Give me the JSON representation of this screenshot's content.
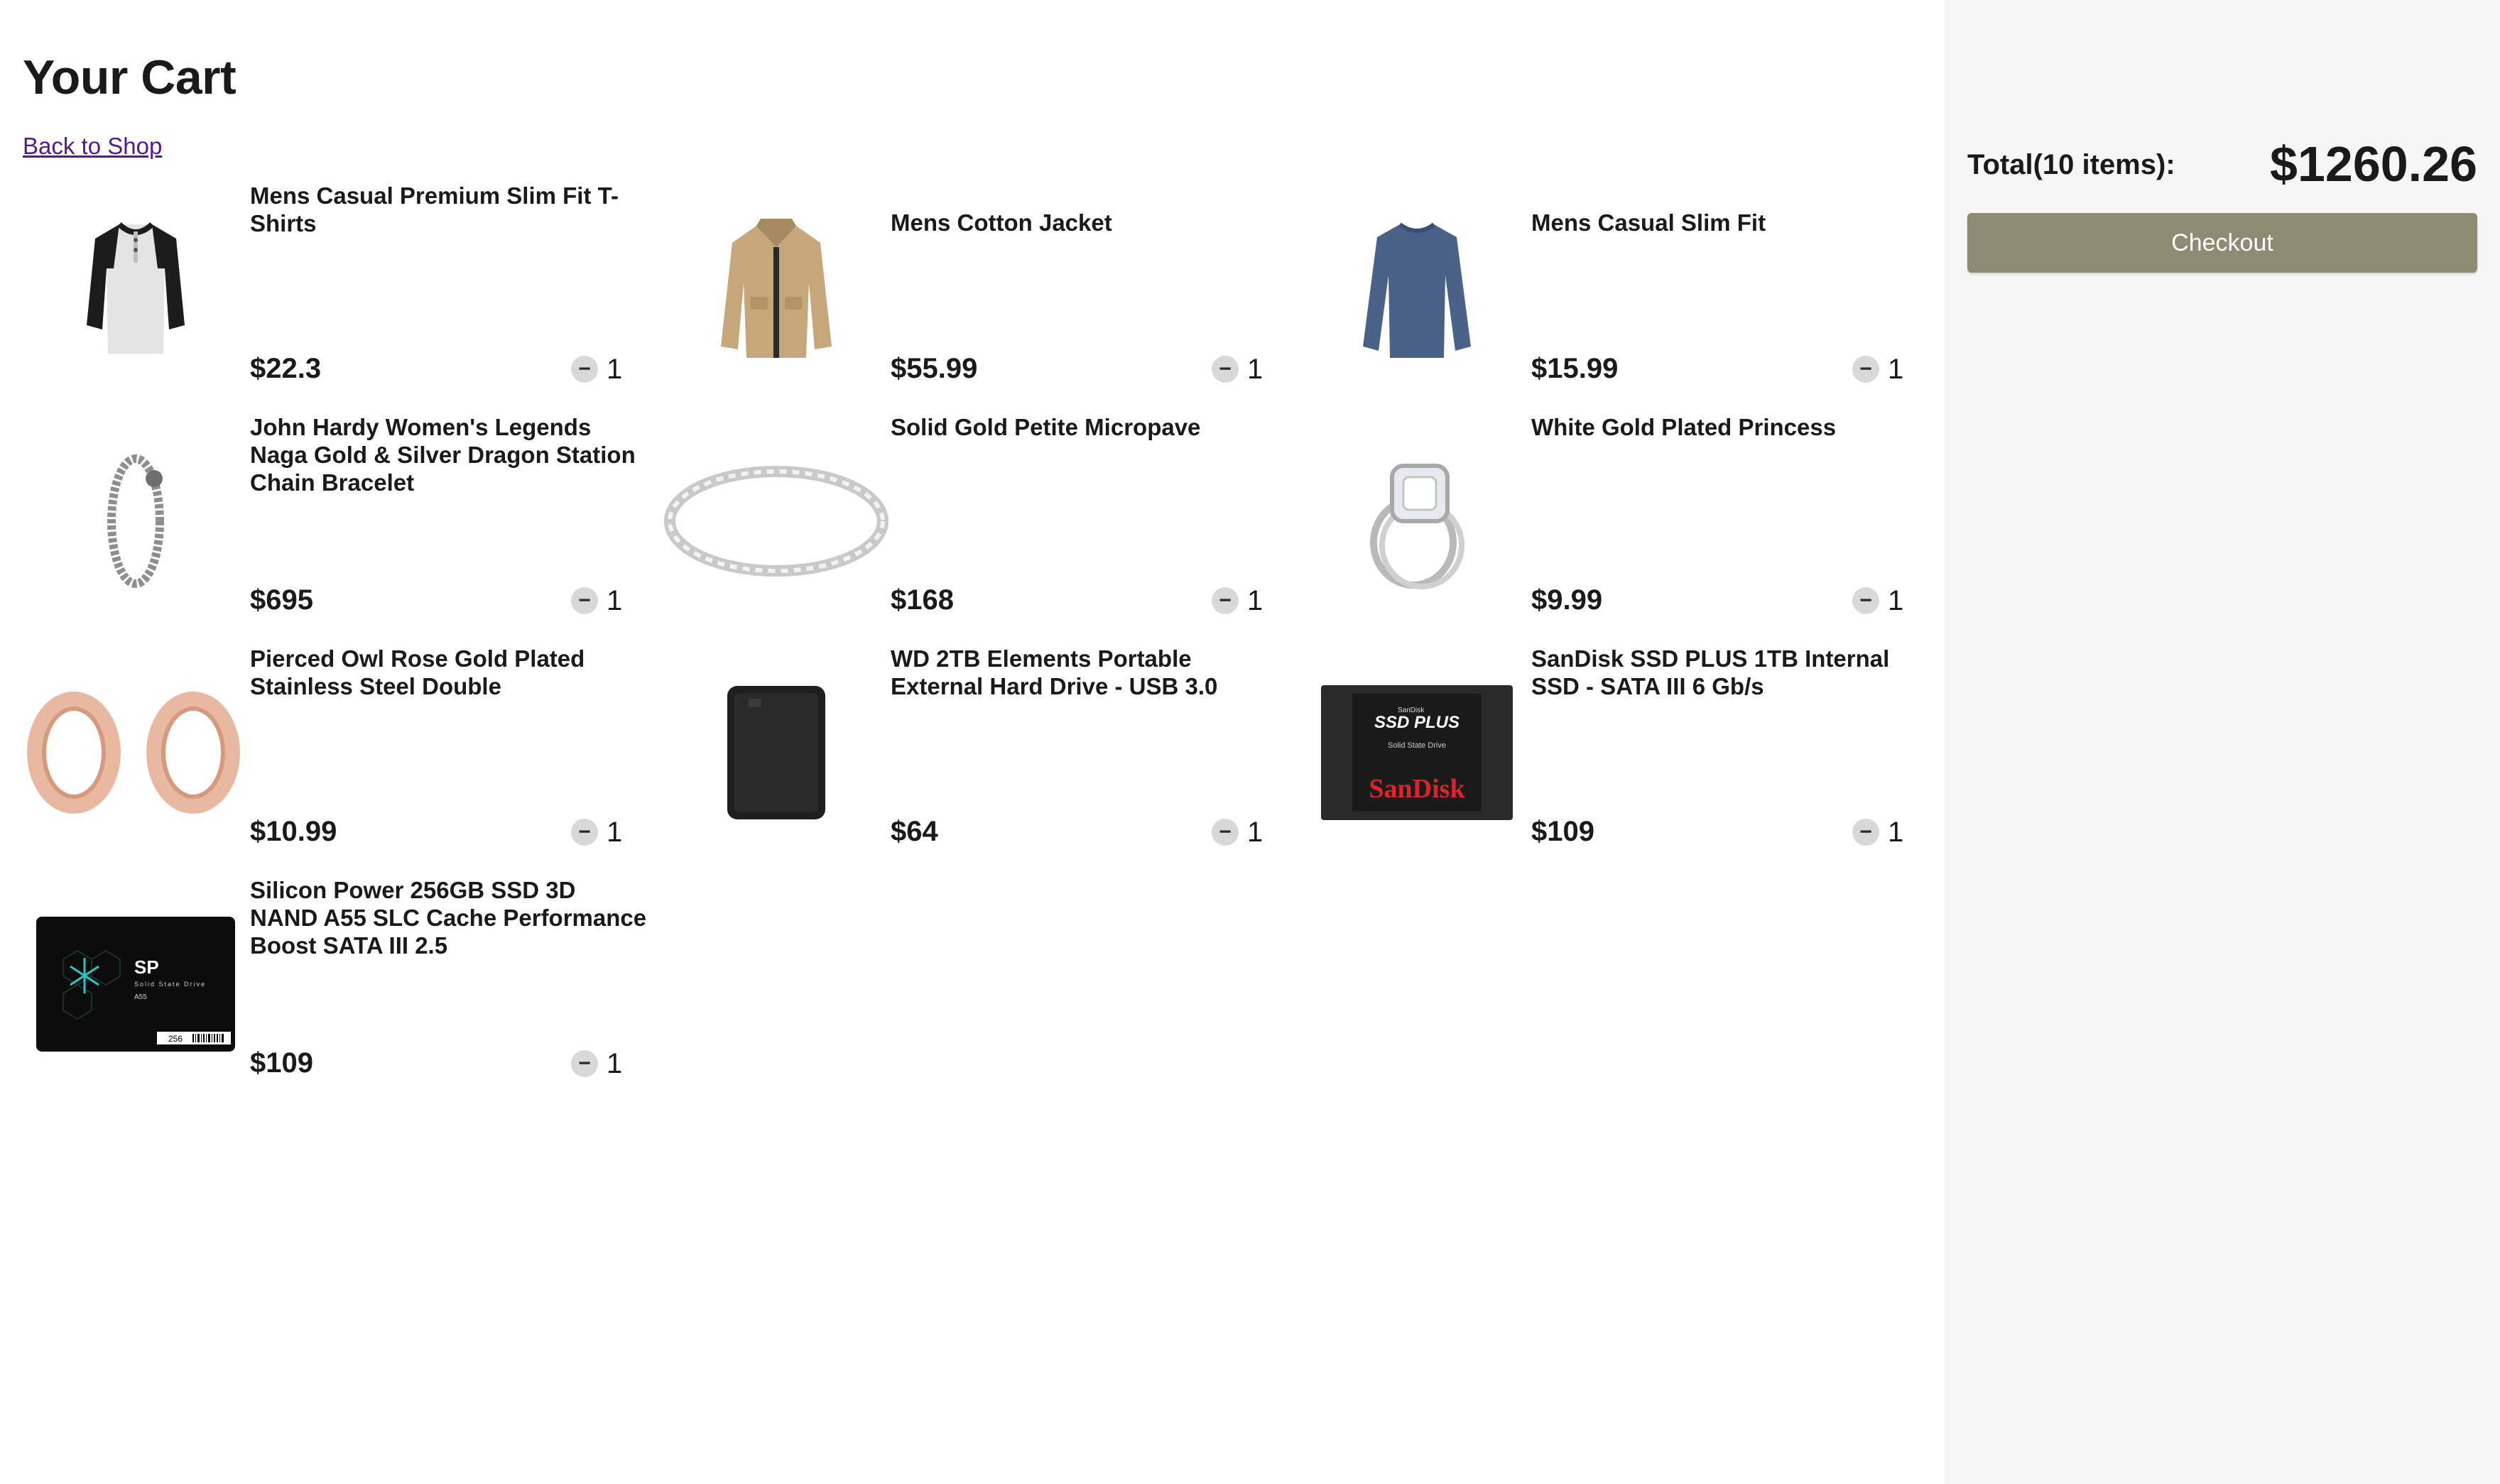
{
  "page": {
    "title": "Your Cart",
    "back_link": "Back to Shop"
  },
  "items": [
    {
      "name": "Mens Casual Premium Slim Fit T-Shirts",
      "price": "$22.3",
      "qty": "1",
      "icon": "tshirt-icon"
    },
    {
      "name": "Mens Cotton Jacket",
      "price": "$55.99",
      "qty": "1",
      "icon": "jacket-icon"
    },
    {
      "name": "Mens Casual Slim Fit",
      "price": "$15.99",
      "qty": "1",
      "icon": "longsleeve-shirt-icon"
    },
    {
      "name": "John Hardy Women's Legends Naga Gold & Silver Dragon Station Chain Bracelet",
      "price": "$695",
      "qty": "1",
      "icon": "bracelet-icon"
    },
    {
      "name": "Solid Gold Petite Micropave",
      "price": "$168",
      "qty": "1",
      "icon": "ring-band-icon"
    },
    {
      "name": "White Gold Plated Princess",
      "price": "$9.99",
      "qty": "1",
      "icon": "diamond-ring-icon"
    },
    {
      "name": "Pierced Owl Rose Gold Plated Stainless Steel Double",
      "price": "$10.99",
      "qty": "1",
      "icon": "ear-tunnels-icon"
    },
    {
      "name": "WD 2TB Elements Portable External Hard Drive - USB 3.0",
      "price": "$64",
      "qty": "1",
      "icon": "hard-drive-icon"
    },
    {
      "name": "SanDisk SSD PLUS 1TB Internal SSD - SATA III 6 Gb/s",
      "price": "$109",
      "qty": "1",
      "icon": "sandisk-ssd-icon",
      "image_text": [
        "SanDisk",
        "SSD PLUS",
        "Solid State Drive",
        "SanDisk"
      ]
    },
    {
      "name": "Silicon Power 256GB SSD 3D NAND A55 SLC Cache Performance Boost SATA III 2.5",
      "price": "$109",
      "qty": "1",
      "icon": "silicon-power-ssd-icon",
      "image_text": [
        "SP",
        "Solid State Drive",
        "A55",
        "256"
      ]
    }
  ],
  "summary": {
    "total_label": "Total(10 items):",
    "total_value": "$1260.26",
    "checkout_label": "Checkout"
  },
  "colors": {
    "sidebar_bg": "#f6f6f6",
    "checkout_bg": "#8c8b73",
    "minus_bg": "#d7d9d6",
    "link": "#551a8b"
  }
}
